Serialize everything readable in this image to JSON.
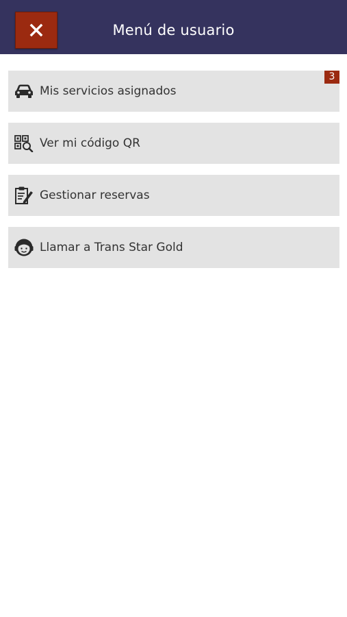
{
  "header": {
    "title": "Menú de usuario",
    "close_icon": "close-icon",
    "background": "#35335e",
    "close_color": "#9b2a10"
  },
  "menu": {
    "items": [
      {
        "label": "Mis servicios asignados",
        "icon": "car-icon",
        "badge": "3"
      },
      {
        "label": "Ver mi código QR",
        "icon": "qr-search-icon"
      },
      {
        "label": "Gestionar reservas",
        "icon": "clipboard-edit-icon"
      },
      {
        "label": "Llamar a Trans Star Gold",
        "icon": "support-agent-icon"
      }
    ],
    "item_background": "#e3e3e3"
  }
}
